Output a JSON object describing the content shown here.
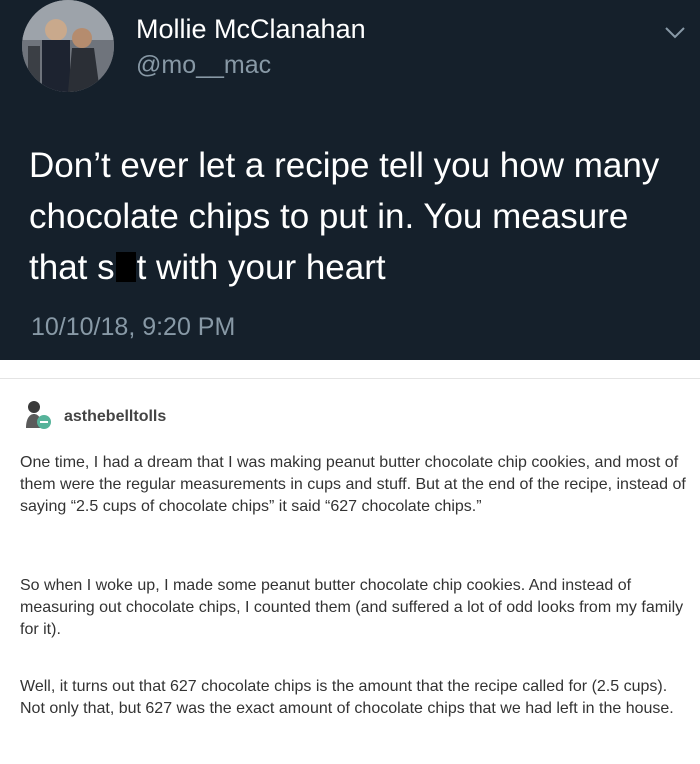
{
  "tweet": {
    "display_name": "Mollie McClanahan",
    "handle": "@mo__mac",
    "text_part1": "Don’t ever let a recipe tell you how many chocolate chips to put in. You measure that s",
    "text_part2": "t with your heart",
    "timestamp": "10/10/18, 9:20 PM",
    "avatar_icon": "profile-photo",
    "menu_icon": "chevron-down-icon",
    "background_color": "#15202b"
  },
  "post": {
    "username": "asthebelltolls",
    "avatar_icon": "user-avatar-icon",
    "paragraphs": [
      "One time, I had a dream that I was making peanut butter chocolate chip cookies, and most of them were the regular measurements in cups and stuff. But at the end of the recipe, instead of saying “2.5 cups of chocolate chips” it said “627 chocolate chips.”",
      "So when I woke up, I made some peanut butter chocolate chip cookies. And instead of measuring out chocolate chips, I counted them (and suffered a lot of odd looks from my family for it).",
      "Well, it turns out that 627 chocolate chips is the amount that the recipe called for (2.5 cups). Not only that, but 627 was the exact amount of chocolate chips that we had left in the house."
    ]
  }
}
